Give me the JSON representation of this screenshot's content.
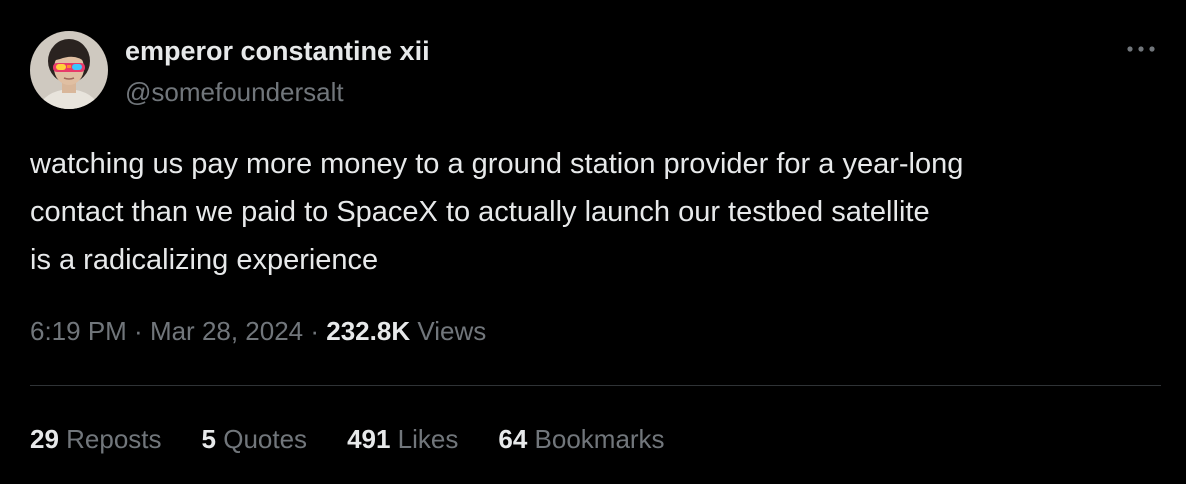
{
  "author": {
    "display_name": "emperor constantine xii",
    "handle": "@somefoundersalt"
  },
  "icons": {
    "more": "more-horizontal-icon",
    "avatar": "profile-photo"
  },
  "tweet": {
    "lines": [
      "watching us pay more money to a ground station provider for a year-long",
      "contact than we paid to SpaceX to actually launch our testbed satellite",
      "is a radicalizing experience"
    ]
  },
  "meta": {
    "time": "6:19 PM",
    "separator": " · ",
    "date": "Mar 28, 2024",
    "views_count": "232.8K",
    "views_label": " Views"
  },
  "stats": {
    "reposts_count": "29",
    "reposts_label": " Reposts",
    "quotes_count": "5",
    "quotes_label": " Quotes",
    "likes_count": "491",
    "likes_label": " Likes",
    "bookmarks_count": "64",
    "bookmarks_label": " Bookmarks"
  },
  "colors": {
    "background": "#000000",
    "primary_text": "#e7e9ea",
    "secondary_text": "#71767b",
    "divider": "#2f3336"
  }
}
